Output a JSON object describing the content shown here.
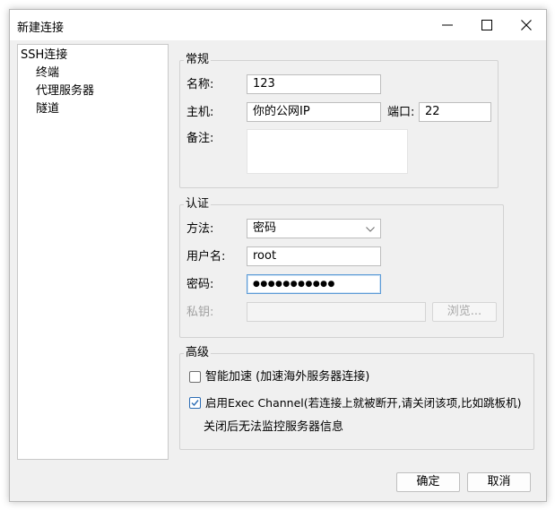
{
  "window": {
    "title": "新建连接"
  },
  "sidebar": {
    "items": [
      {
        "label": "SSH连接"
      },
      {
        "label": "终端"
      },
      {
        "label": "代理服务器"
      },
      {
        "label": "隧道"
      }
    ]
  },
  "general": {
    "group_label": "常规",
    "name_label": "名称:",
    "name_value": "123",
    "host_label": "主机:",
    "host_value": "你的公网IP",
    "port_label": "端口:",
    "port_value": "22",
    "notes_label": "备注:",
    "notes_value": ""
  },
  "auth": {
    "group_label": "认证",
    "method_label": "方法:",
    "method_value": "密码",
    "username_label": "用户名:",
    "username_value": "root",
    "password_label": "密码:",
    "password_value": "●●●●●●●●●●●",
    "key_label": "私钥:",
    "key_value": "",
    "browse_label": "浏览..."
  },
  "advanced": {
    "group_label": "高级",
    "smart_accel_label": "智能加速 (加速海外服务器连接)",
    "smart_accel_checked": false,
    "exec_channel_label": "启用Exec Channel(若连接上就被断开,请关闭该项,比如跳板机)",
    "exec_channel_checked": true,
    "exec_channel_note": "关闭后无法监控服务器信息"
  },
  "footer": {
    "ok_label": "确定",
    "cancel_label": "取消"
  },
  "icons": {
    "minimize": "minimize-icon",
    "maximize": "maximize-icon",
    "close": "close-icon",
    "dropdown": "chevron-down-icon",
    "checkmark": "checkmark-icon"
  },
  "colors": {
    "focus_border": "#5d9bd6",
    "checkbox_accent": "#2c6db5"
  }
}
